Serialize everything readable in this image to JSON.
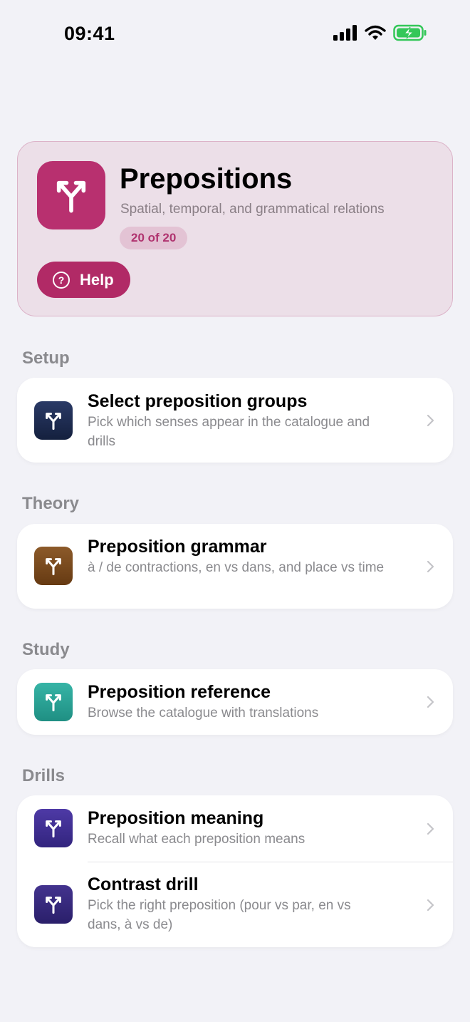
{
  "status_bar": {
    "time": "09:41"
  },
  "header": {
    "title": "Prepositions",
    "subtitle": "Spatial, temporal, and grammatical relations",
    "badge": "20 of 20",
    "help_label": "Help",
    "help_glyph": "?",
    "accent_color": "#b8306f"
  },
  "sections": {
    "setup": {
      "heading": "Setup",
      "items": [
        {
          "title": "Select preposition groups",
          "description": "Pick which senses appear in the catalogue and drills",
          "icon": "fork-arrow-icon",
          "color": "#1e2a4f"
        }
      ]
    },
    "theory": {
      "heading": "Theory",
      "items": [
        {
          "title": "Preposition grammar",
          "description": "à / de contractions, en vs dans, and place vs time",
          "icon": "fork-arrow-icon",
          "color": "#7a4a1c"
        }
      ]
    },
    "study": {
      "heading": "Study",
      "items": [
        {
          "title": "Preposition reference",
          "description": "Browse the catalogue with translations",
          "icon": "fork-arrow-icon",
          "color": "#2aa396"
        }
      ]
    },
    "drills": {
      "heading": "Drills",
      "items": [
        {
          "title": "Preposition meaning",
          "description": "Recall what each preposition means",
          "icon": "fork-arrow-icon",
          "color": "#3d2d8f"
        },
        {
          "title": "Contrast drill",
          "description": "Pick the right preposition (pour vs par, en vs dans, à vs de)",
          "icon": "fork-arrow-icon",
          "color": "#33287a"
        }
      ]
    }
  }
}
